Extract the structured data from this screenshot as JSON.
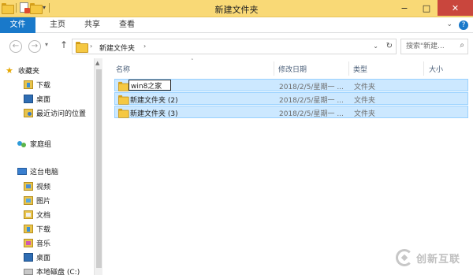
{
  "window": {
    "title": "新建文件夹",
    "minimize": "−",
    "maximize": "□",
    "close": "✕"
  },
  "ribbon": {
    "tabs": [
      "文件",
      "主页",
      "共享",
      "查看"
    ],
    "expand": "⌄",
    "help": "?"
  },
  "nav": {
    "back": "←",
    "forward": "→",
    "recent": "▾",
    "up": "↑",
    "breadcrumb": "新建文件夹",
    "crumb_sep": "›",
    "dropdown": "⌄",
    "refresh": "↻",
    "search_placeholder": "搜索\"新建...",
    "search_icon": "⌕"
  },
  "sidebar": {
    "favorites": "收藏夹",
    "fav_items": [
      "下载",
      "桌面",
      "最近访问的位置"
    ],
    "homegroup": "家庭组",
    "thispc": "这台电脑",
    "pc_items": [
      "视频",
      "图片",
      "文档",
      "下载",
      "音乐",
      "桌面",
      "本地磁盘 (C:)"
    ]
  },
  "columns": {
    "name": "名称",
    "date": "修改日期",
    "type": "类型",
    "size": "大小",
    "sort_indicator": "˄"
  },
  "files": [
    {
      "name": "win8之家",
      "date": "2018/2/5/星期一 ...",
      "type": "文件夹",
      "renaming": true
    },
    {
      "name": "新建文件夹 (2)",
      "date": "2018/2/5/星期一 ...",
      "type": "文件夹"
    },
    {
      "name": "新建文件夹 (3)",
      "date": "2018/2/5/星期一 ...",
      "type": "文件夹"
    }
  ],
  "watermark": {
    "text": "创新互联"
  },
  "colors": {
    "accent": "#1979ca",
    "titlebar": "#f9d976",
    "selection": "#cce8ff",
    "selection_border": "#99d1ff"
  }
}
